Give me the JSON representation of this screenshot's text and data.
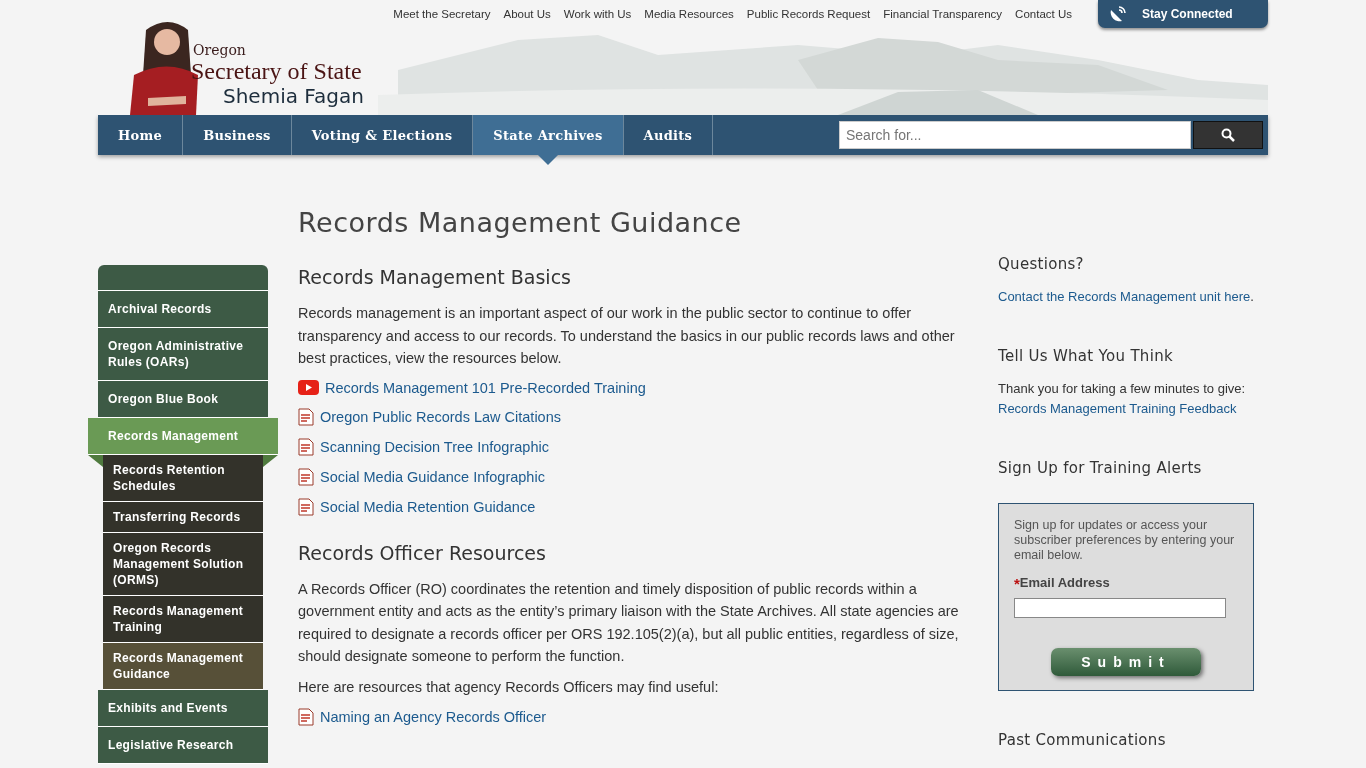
{
  "top_links": [
    "Meet the Secretary",
    "About Us",
    "Work with Us",
    "Media Resources",
    "Public Records Request",
    "Financial Transparency",
    "Contact Us"
  ],
  "stay_connected": "Stay Connected",
  "logo": {
    "state": "Oregon",
    "title": "Secretary of State",
    "name": "Shemia Fagan"
  },
  "nav": [
    {
      "label": "Home",
      "selected": false
    },
    {
      "label": "Business",
      "selected": false
    },
    {
      "label": "Voting & Elections",
      "selected": false
    },
    {
      "label": "State Archives",
      "selected": true
    },
    {
      "label": "Audits",
      "selected": false
    }
  ],
  "search": {
    "placeholder": "Search for..."
  },
  "sidebar": {
    "items": [
      {
        "label": "Archival Records",
        "selected": false
      },
      {
        "label": "Oregon Administrative Rules (OARs)",
        "selected": false
      },
      {
        "label": "Oregon Blue Book",
        "selected": false
      },
      {
        "label": "Records Management",
        "selected": true,
        "children": [
          {
            "label": "Records Retention Schedules",
            "selected": false
          },
          {
            "label": "Transferring Records",
            "selected": false
          },
          {
            "label": "Oregon Records Management Solution (ORMS)",
            "selected": false
          },
          {
            "label": "Records Management Training",
            "selected": false
          },
          {
            "label": "Records Management Guidance",
            "selected": true
          }
        ]
      },
      {
        "label": "Exhibits and Events",
        "selected": false
      },
      {
        "label": "Legislative Research",
        "selected": false
      }
    ]
  },
  "main": {
    "title": "Records Management Guidance",
    "sections": [
      {
        "heading": "Records Management Basics",
        "paragraphs": [
          "Records management is an important aspect of our work in the public sector to continue to offer transparency and access to our records. To understand the basics in our public records laws and other best practices, view the resources below."
        ],
        "links": [
          {
            "kind": "video",
            "text": "Records Management 101 Pre-Recorded Training"
          },
          {
            "kind": "pdf",
            "text": "Oregon Public Records Law Citations"
          },
          {
            "kind": "pdf",
            "text": "Scanning Decision Tree Infographic"
          },
          {
            "kind": "pdf",
            "text": "Social Media Guidance Infographic"
          },
          {
            "kind": "pdf",
            "text": "Social Media Retention Guidance"
          }
        ]
      },
      {
        "heading": "Records Officer Resources",
        "paragraphs": [
          "A Records Officer (RO) coordinates the retention and timely disposition of public records within a government entity and acts as the entity’s primary liaison with the State Archives. All state agencies are required to designate a records officer per ORS 192.105(2)(a), but all public entities, regardless of size, should designate someone to perform the function.",
          "Here are resources that agency Records Officers may find useful:"
        ],
        "links": [
          {
            "kind": "pdf",
            "text": "Naming an Agency Records Officer"
          }
        ]
      }
    ]
  },
  "aside": {
    "questions": {
      "heading": "Questions?",
      "link": "Contact the Records Management unit here",
      "after": "."
    },
    "feedback": {
      "heading": "Tell Us What You Think",
      "text": "Thank you for taking a few minutes to give:",
      "link": "Records Management Training Feedback"
    },
    "signup": {
      "heading": "Sign Up for Training Alerts",
      "intro": "Sign up for updates or access your subscriber preferences by entering your email below.",
      "required_mark": "*",
      "label": "Email Address",
      "button": "Submit"
    },
    "past": {
      "heading": "Past Communications"
    }
  }
}
